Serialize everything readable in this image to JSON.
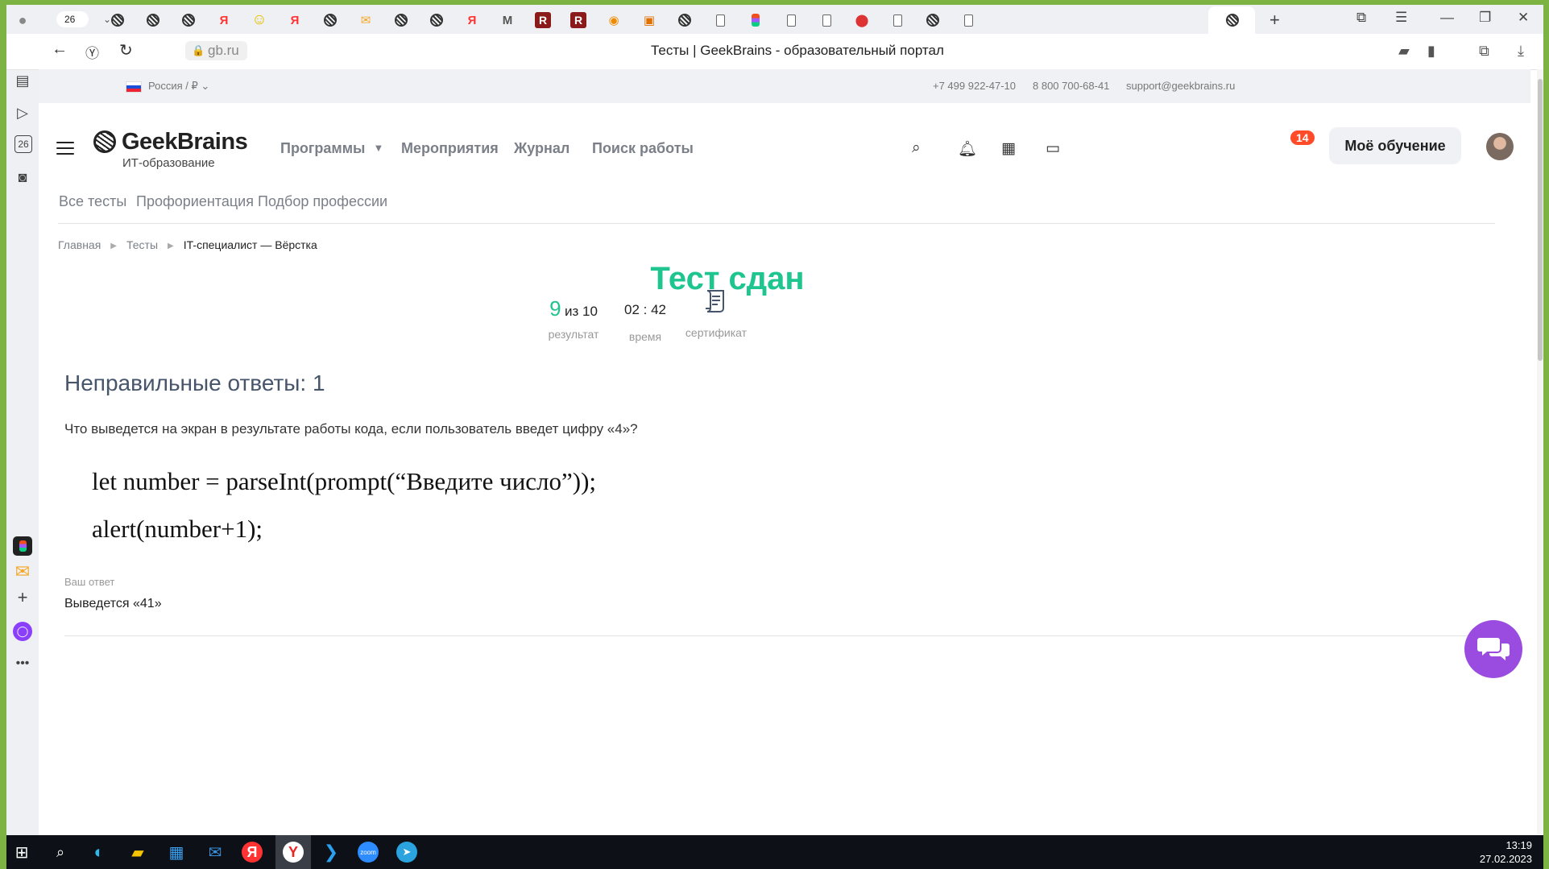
{
  "browser": {
    "tab_count": "26",
    "url": "gb.ru",
    "page_title": "Тесты | GeekBrains - образовательный портал",
    "sidebar_date": "26"
  },
  "site": {
    "topbar": {
      "region": "Россия / ₽",
      "phone1": "+7 499 922-47-10",
      "phone2": "8 800 700-68-41",
      "email": "support@geekbrains.ru"
    },
    "logo": {
      "name": "GeekBrains",
      "subtitle": "ИТ-образование"
    },
    "nav": [
      "Программы",
      "Мероприятия",
      "Журнал",
      "Поиск работы"
    ],
    "notifications_badge": "14",
    "my_learning": "Моё обучение",
    "subnav": [
      "Все тесты",
      "Профориентация",
      "Подбор профессии"
    ],
    "breadcrumbs": [
      "Главная",
      "Тесты",
      "IT-специалист — Вёрстка"
    ]
  },
  "result": {
    "title": "Тест сдан",
    "score": "9",
    "score_total": "из 10",
    "score_label": "результат",
    "time": "02 : 42",
    "time_label": "время",
    "certificate_label": "сертификат"
  },
  "wrong": {
    "title": "Неправильные ответы: 1",
    "question": "Что выведется на экран в результате работы кода, если пользователь введет цифру «4»?",
    "code_lines": [
      "let number = parseInt(prompt(“Введите число”));",
      "alert(number+1);"
    ],
    "answer_label": "Ваш ответ",
    "answer_value": "Выведется «41»"
  },
  "taskbar": {
    "time": "13:19",
    "date": "27.02.2023"
  },
  "colors": {
    "accent_green": "#1fc58f",
    "badge": "#ff4b28",
    "chat": "#9b4ce0"
  }
}
